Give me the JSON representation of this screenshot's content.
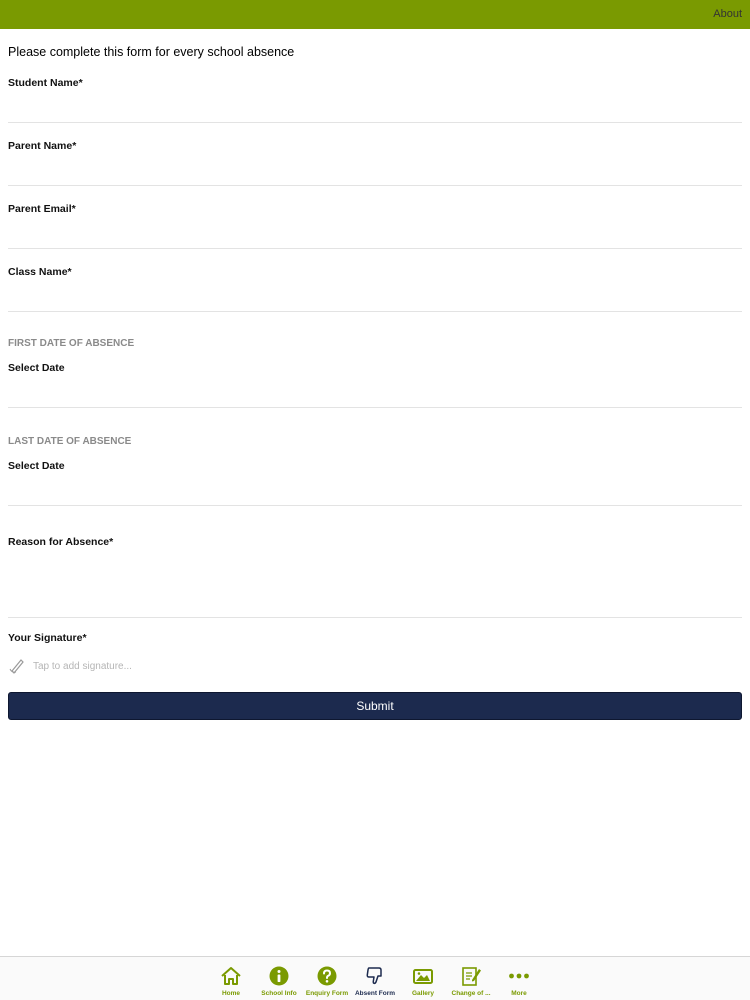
{
  "header": {
    "about_label": "About"
  },
  "intro_text": "Please complete this form for every school absence",
  "fields": {
    "student_name": {
      "label": "Student Name*",
      "value": ""
    },
    "parent_name": {
      "label": "Parent Name*",
      "value": ""
    },
    "parent_email": {
      "label": "Parent Email*",
      "value": ""
    },
    "class_name": {
      "label": "Class Name*",
      "value": ""
    },
    "reason": {
      "label": "Reason for Absence*",
      "value": ""
    }
  },
  "first_date": {
    "heading": "FIRST DATE OF ABSENCE",
    "label": "Select Date"
  },
  "last_date": {
    "heading": "LAST DATE OF ABSENCE",
    "label": "Select Date"
  },
  "signature": {
    "label": "Your Signature*",
    "placeholder": "Tap to add signature..."
  },
  "submit_label": "Submit",
  "tabs": [
    {
      "label": "Home",
      "icon": "home-icon"
    },
    {
      "label": "School Info",
      "icon": "info-icon"
    },
    {
      "label": "Enquiry Form",
      "icon": "question-icon"
    },
    {
      "label": "Absent Form",
      "icon": "thumbs-down-icon"
    },
    {
      "label": "Gallery",
      "icon": "gallery-icon"
    },
    {
      "label": "Change of ...",
      "icon": "edit-form-icon"
    },
    {
      "label": "More",
      "icon": "more-icon"
    }
  ],
  "colors": {
    "brand_green": "#7a9a01",
    "submit_navy": "#1c2a4e",
    "active_tab": "#1c2a4e"
  }
}
